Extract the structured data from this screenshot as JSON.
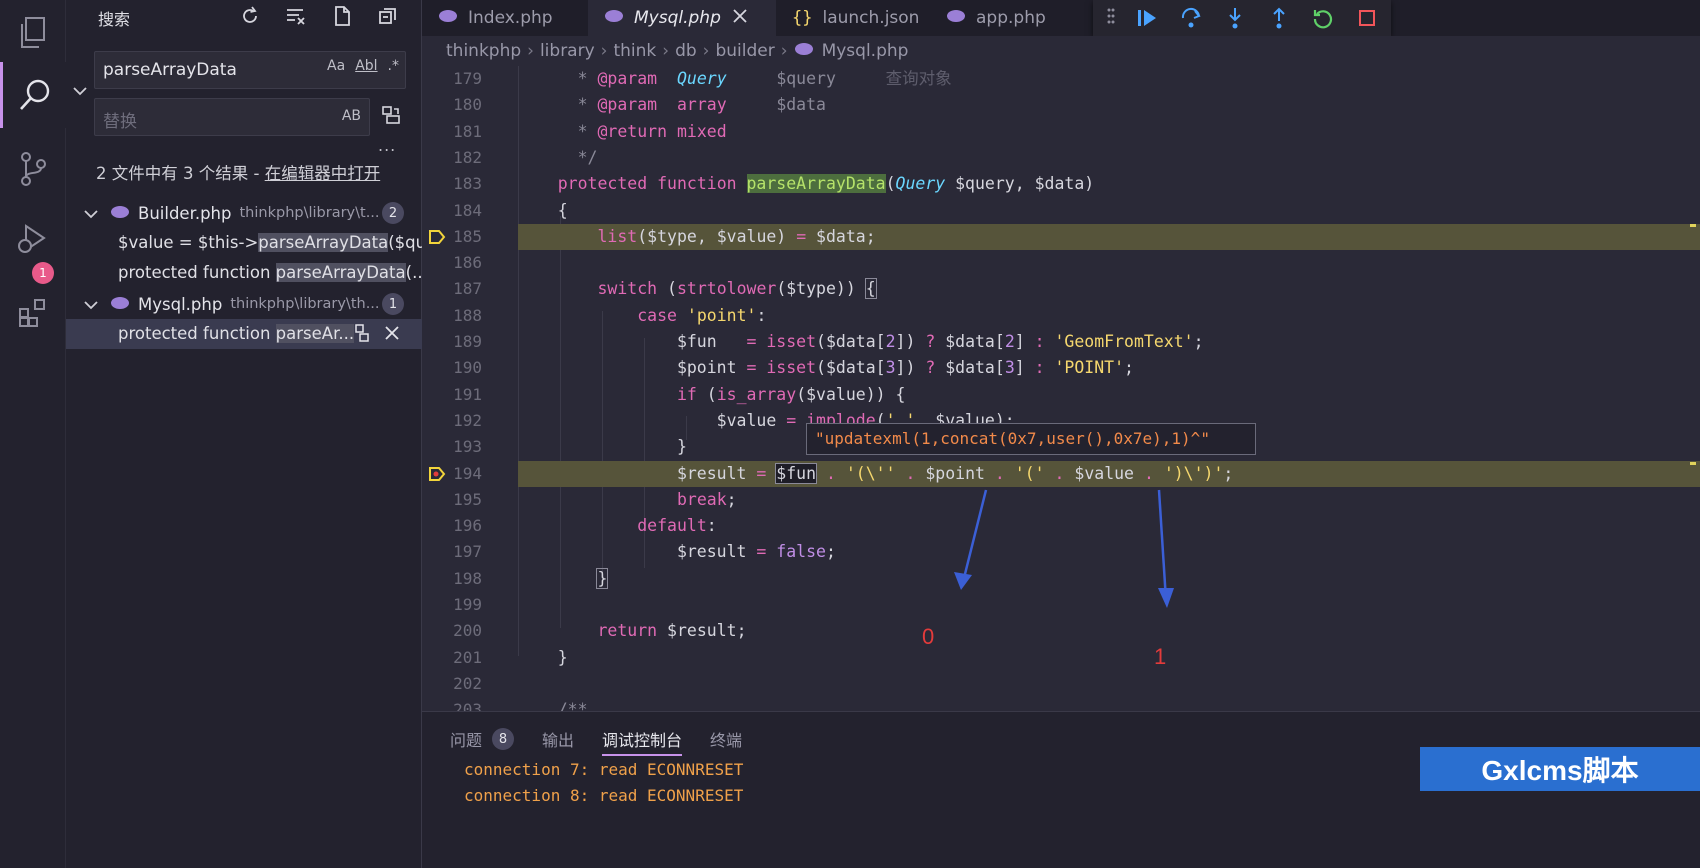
{
  "tabs": [
    {
      "label": "Index.php",
      "icon": "php-icon"
    },
    {
      "label": "Mysql.php",
      "icon": "php-icon",
      "active": true
    },
    {
      "label": "launch.json",
      "icon": "json-icon"
    },
    {
      "label": "app.php",
      "icon": "php-icon"
    }
  ],
  "breadcrumb": [
    "thinkphp",
    "library",
    "think",
    "db",
    "builder",
    "Mysql.php"
  ],
  "sidebar": {
    "title": "搜索",
    "search_value": "parseArrayData",
    "search_opts": [
      "Aa",
      "Abl",
      ".*"
    ],
    "replace_placeholder": "替换",
    "replace_opt": "AB",
    "more": "...",
    "summary_text": "2 文件中有 3 个结果 - ",
    "summary_link": "在编辑器中打开",
    "files": [
      {
        "name": "Builder.php",
        "path": "thinkphp\\library\\t...",
        "count": "2",
        "matches": [
          {
            "pre": "$value = $this->",
            "hit": "parseArrayData",
            "post": "($qu..."
          },
          {
            "pre": "protected function ",
            "hit": "parseArrayData",
            "post": "(..."
          }
        ]
      },
      {
        "name": "Mysql.php",
        "path": "thinkphp\\library\\th...",
        "count": "1",
        "matches": [
          {
            "pre": "protected function ",
            "hit": "parseAr...",
            "post": ""
          }
        ]
      }
    ]
  },
  "activity": {
    "debug_badge": "1"
  },
  "editor": {
    "line_numbers": [
      "179",
      "180",
      "181",
      "182",
      "183",
      "184",
      "185",
      "186",
      "187",
      "188",
      "189",
      "190",
      "191",
      "192",
      "193",
      "194",
      "195",
      "196",
      "197",
      "198",
      "199",
      "200",
      "201",
      "202",
      "203"
    ],
    "tooltip": "\"updatexml(1,concat(0x7,user(),0x7e),1)^\"",
    "annotations": [
      "0",
      "1"
    ]
  },
  "panel": {
    "tabs": [
      {
        "label": "问题",
        "badge": "8"
      },
      {
        "label": "输出"
      },
      {
        "label": "调试控制台",
        "active": true
      },
      {
        "label": "终端"
      }
    ],
    "console": [
      "connection 7: read ECONNRESET",
      "connection 8: read ECONNRESET"
    ]
  },
  "watermark": "Gxlcms脚本",
  "colors": {
    "accent": "#c792ea",
    "current_line": "#56543a",
    "string": "#f5d76e",
    "keyword": "#e06ab5",
    "type": "#6bd7ff",
    "console": "#f0a14a",
    "annotation": "#e33b3b",
    "arrow": "#3b5fd6"
  }
}
